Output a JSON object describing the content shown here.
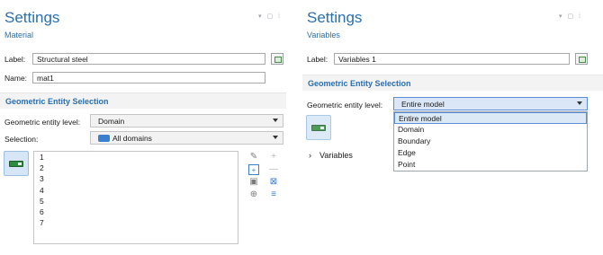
{
  "left": {
    "title": "Settings",
    "subtitle": "Material",
    "window_controls": "▾ ▢ ⁞",
    "label_caption": "Label:",
    "label_value": "Structural steel",
    "name_caption": "Name:",
    "name_value": "mat1",
    "section_title": "Geometric Entity Selection",
    "entity_level_caption": "Geometric entity level:",
    "entity_level_value": "Domain",
    "selection_caption": "Selection:",
    "selection_value": "All domains",
    "list_items": [
      "1",
      "2",
      "3",
      "4",
      "5",
      "6",
      "7"
    ]
  },
  "right": {
    "title": "Settings",
    "subtitle": "Variables",
    "window_controls": "▾ ▢ ⁞",
    "label_caption": "Label:",
    "label_value": "Variables 1",
    "section_title": "Geometric Entity Selection",
    "entity_level_caption": "Geometric entity level:",
    "entity_level_value": "Entire model",
    "dropdown_options": [
      "Entire model",
      "Domain",
      "Boundary",
      "Edge",
      "Point"
    ],
    "variables_label": "Variables"
  },
  "colors": {
    "title_blue": "#2b6fad",
    "section_bg": "#f3f3f3",
    "domain_chip": "#3b7fd1",
    "toggle_green": "#2e8a3e"
  },
  "icons": [
    "edit-label-icon",
    "selection-toggle-icon",
    "paste-icon",
    "copy-icon",
    "clipboard-icon",
    "zoom-selection-icon",
    "add-icon",
    "remove-icon",
    "clear-selection-icon",
    "show-selection-icon",
    "chevron-right-icon"
  ]
}
